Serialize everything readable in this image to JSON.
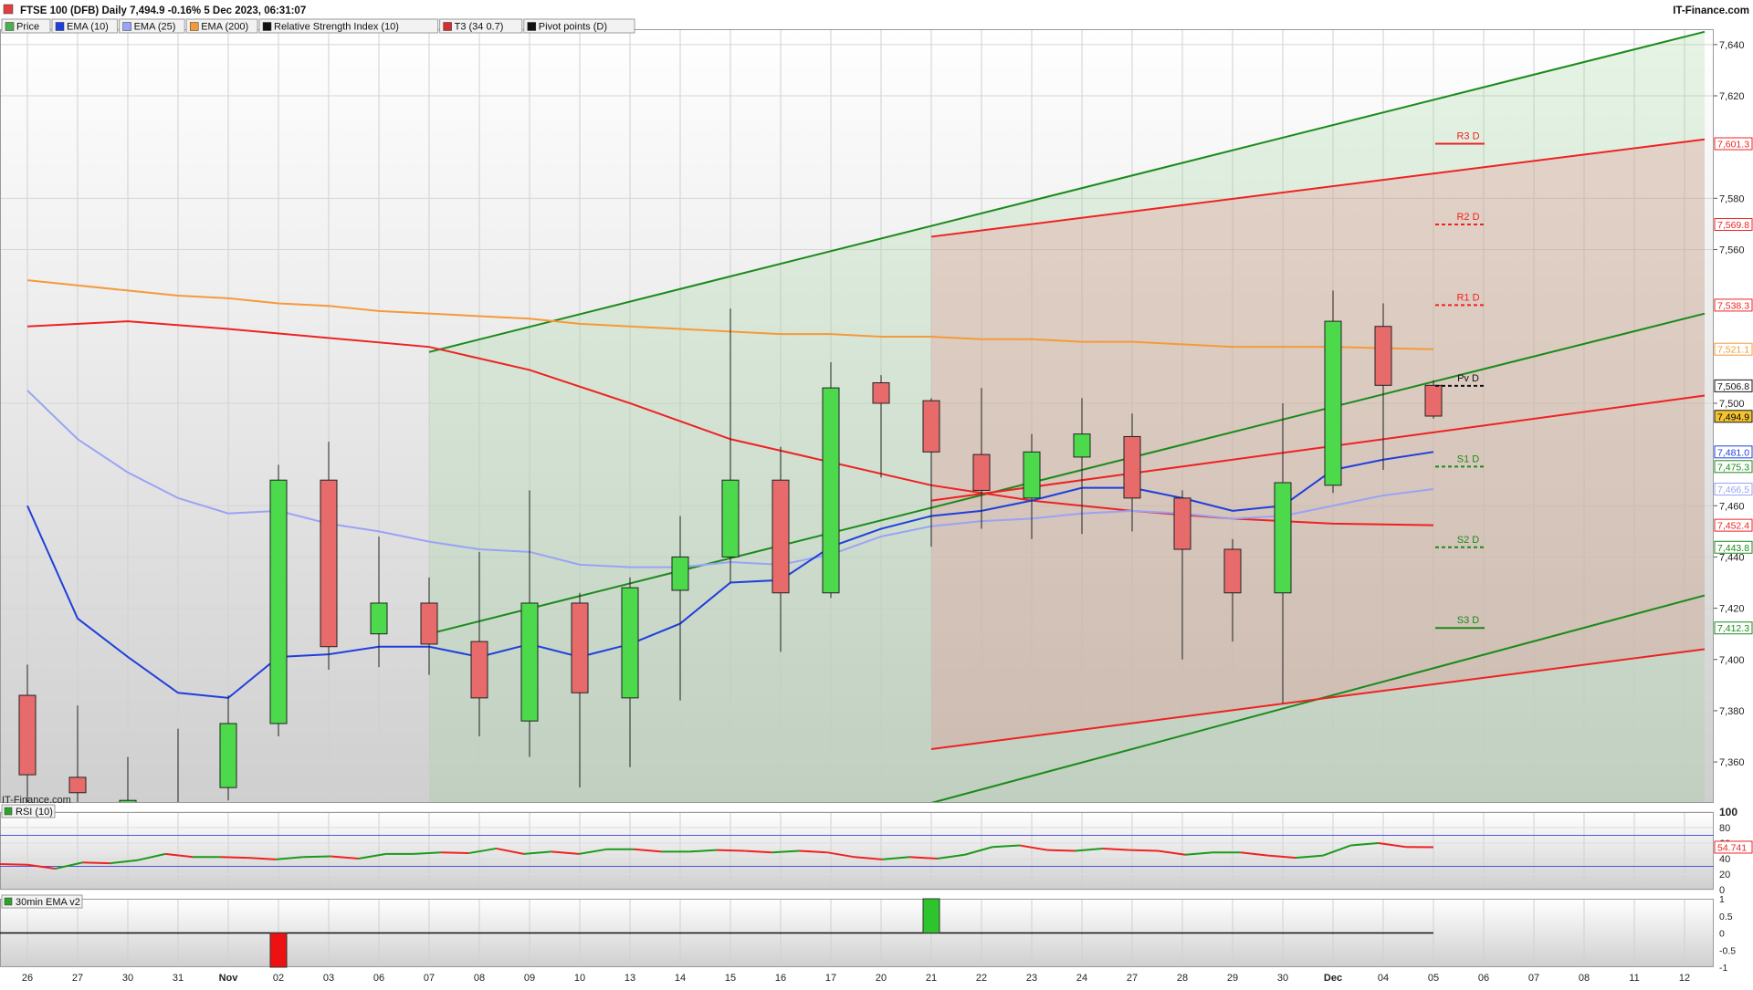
{
  "header": {
    "title": "FTSE 100 (DFB) Daily 7,494.9 -0.16% 5 Dec 2023, 06:31:07",
    "brand": "IT-Finance.com",
    "watermark": "IT-Finance.com"
  },
  "legend": [
    {
      "label": "Price",
      "color": "#4caf50"
    },
    {
      "label": "EMA (10)",
      "color": "#1f3fdd"
    },
    {
      "label": "EMA (25)",
      "color": "#9aa3f5"
    },
    {
      "label": "EMA (200)",
      "color": "#f59a3a"
    },
    {
      "label": "Relative Strength Index (10)",
      "color": "#111111"
    },
    {
      "label": "T3 (34 0.7)",
      "color": "#d32f2f"
    },
    {
      "label": "Pivot points (D)",
      "color": "#111111"
    }
  ],
  "colors": {
    "up": "#4cd94c",
    "down": "#e86b6b",
    "ema10": "#1f3fdd",
    "ema25": "#9aa3f5",
    "ema200": "#f59a3a",
    "t3": "#ee2222",
    "channel_green": "#1a8a1a",
    "channel_red": "#ee2222"
  },
  "chart_data": [
    {
      "type": "candlestick",
      "title": "FTSE 100 (DFB) Daily",
      "x_labels": [
        "26",
        "27",
        "30",
        "31",
        "Nov",
        "02",
        "03",
        "06",
        "07",
        "08",
        "09",
        "10",
        "13",
        "14",
        "15",
        "16",
        "17",
        "20",
        "21",
        "22",
        "23",
        "24",
        "27",
        "28",
        "29",
        "30",
        "Dec",
        "04",
        "05",
        "06",
        "07",
        "08",
        "11",
        "12"
      ],
      "ylim": [
        7344,
        7646
      ],
      "y_ticks": [
        7360,
        7380,
        7400,
        7420,
        7440,
        7460,
        7500,
        7560,
        7580,
        7620,
        7640
      ],
      "candles": [
        {
          "o": 7386,
          "h": 7398,
          "l": 7340,
          "c": 7355
        },
        {
          "o": 7354,
          "h": 7382,
          "l": 7340,
          "c": 7348
        },
        {
          "o": 7340,
          "h": 7362,
          "l": 7330,
          "c": 7345
        },
        {
          "o": 7340,
          "h": 7373,
          "l": 7333,
          "c": 7338
        },
        {
          "o": 7350,
          "h": 7386,
          "l": 7345,
          "c": 7375
        },
        {
          "o": 7375,
          "h": 7476,
          "l": 7370,
          "c": 7470
        },
        {
          "o": 7470,
          "h": 7485,
          "l": 7396,
          "c": 7405
        },
        {
          "o": 7410,
          "h": 7448,
          "l": 7397,
          "c": 7422
        },
        {
          "o": 7422,
          "h": 7432,
          "l": 7394,
          "c": 7406
        },
        {
          "o": 7407,
          "h": 7442,
          "l": 7370,
          "c": 7385
        },
        {
          "o": 7376,
          "h": 7466,
          "l": 7362,
          "c": 7422
        },
        {
          "o": 7422,
          "h": 7426,
          "l": 7350,
          "c": 7387
        },
        {
          "o": 7385,
          "h": 7432,
          "l": 7358,
          "c": 7428
        },
        {
          "o": 7427,
          "h": 7456,
          "l": 7384,
          "c": 7440
        },
        {
          "o": 7440,
          "h": 7537,
          "l": 7430,
          "c": 7470
        },
        {
          "o": 7470,
          "h": 7483,
          "l": 7403,
          "c": 7426
        },
        {
          "o": 7426,
          "h": 7516,
          "l": 7424,
          "c": 7506
        },
        {
          "o": 7508,
          "h": 7511,
          "l": 7471,
          "c": 7500
        },
        {
          "o": 7501,
          "h": 7502,
          "l": 7444,
          "c": 7481
        },
        {
          "o": 7480,
          "h": 7506,
          "l": 7451,
          "c": 7466
        },
        {
          "o": 7463,
          "h": 7488,
          "l": 7447,
          "c": 7481
        },
        {
          "o": 7479,
          "h": 7502,
          "l": 7449,
          "c": 7488
        },
        {
          "o": 7487,
          "h": 7496,
          "l": 7450,
          "c": 7463
        },
        {
          "o": 7463,
          "h": 7466,
          "l": 7400,
          "c": 7443
        },
        {
          "o": 7443,
          "h": 7447,
          "l": 7407,
          "c": 7426
        },
        {
          "o": 7426,
          "h": 7500,
          "l": 7383,
          "c": 7469
        },
        {
          "o": 7468,
          "h": 7544,
          "l": 7465,
          "c": 7532
        },
        {
          "o": 7530,
          "h": 7539,
          "l": 7474,
          "c": 7507
        },
        {
          "o": 7507,
          "h": 7509,
          "l": 7494,
          "c": 7495
        }
      ],
      "ema10": [
        7460,
        7416,
        7401,
        7387,
        7385,
        7401,
        7402,
        7405,
        7405,
        7401,
        7406,
        7401,
        7406,
        7414,
        7430,
        7431,
        7444,
        7451,
        7456,
        7458,
        7462,
        7467,
        7467,
        7463,
        7458,
        7460,
        7474,
        7478,
        7481
      ],
      "ema25": [
        7505,
        7486,
        7473,
        7463,
        7457,
        7458,
        7453,
        7450,
        7446,
        7443,
        7442,
        7437,
        7436,
        7436,
        7438,
        7437,
        7441,
        7448,
        7452,
        7454,
        7455,
        7457,
        7458,
        7457,
        7455,
        7456,
        7460,
        7464,
        7466.5
      ],
      "ema200": [
        7548,
        7546,
        7544,
        7542,
        7541,
        7539,
        7538,
        7536,
        7535,
        7534,
        7533,
        7531,
        7530,
        7529,
        7528,
        7527,
        7527,
        7526,
        7526,
        7525,
        7525,
        7524,
        7524,
        7523,
        7522,
        7522,
        7522,
        7521.5,
        7521.1
      ],
      "t3_line": [
        {
          "x": 0,
          "y": 7530
        },
        {
          "x": 2,
          "y": 7532
        },
        {
          "x": 4,
          "y": 7529
        },
        {
          "x": 8,
          "y": 7522
        },
        {
          "x": 10,
          "y": 7513
        },
        {
          "x": 12,
          "y": 7500
        },
        {
          "x": 14,
          "y": 7486
        },
        {
          "x": 16,
          "y": 7477
        },
        {
          "x": 18,
          "y": 7468
        },
        {
          "x": 20,
          "y": 7462
        },
        {
          "x": 22,
          "y": 7458
        },
        {
          "x": 24,
          "y": 7455
        },
        {
          "x": 26,
          "y": 7453
        },
        {
          "x": 28,
          "y": 7452.4
        }
      ],
      "channel_green_upper": [
        {
          "x": 8,
          "y": 7520
        },
        {
          "x": 33.4,
          "y": 7645
        }
      ],
      "channel_green_middle": [
        {
          "x": 8,
          "y": 7410
        },
        {
          "x": 33.4,
          "y": 7535
        }
      ],
      "channel_green_lower": [
        {
          "x": 18,
          "y": 7344
        },
        {
          "x": 33.4,
          "y": 7425
        }
      ],
      "channel_red_upper": [
        {
          "x": 18,
          "y": 7565
        },
        {
          "x": 33.4,
          "y": 7603
        }
      ],
      "channel_red_middle": [
        {
          "x": 18,
          "y": 7462
        },
        {
          "x": 33.4,
          "y": 7503
        }
      ],
      "channel_red_lower": [
        {
          "x": 18,
          "y": 7365
        },
        {
          "x": 33.4,
          "y": 7404
        }
      ],
      "pivots": [
        {
          "label": "R3 D",
          "value": 7601.3,
          "color": "#ee2222",
          "style": "solid"
        },
        {
          "label": "R2 D",
          "value": 7569.8,
          "color": "#ee2222",
          "style": "dashed"
        },
        {
          "label": "R1 D",
          "value": 7538.3,
          "color": "#ee2222",
          "style": "dashed"
        },
        {
          "label": "Pv D",
          "value": 7506.8,
          "color": "#111111",
          "style": "dashed"
        },
        {
          "label": "S1 D",
          "value": 7475.3,
          "color": "#1a8a1a",
          "style": "dashed"
        },
        {
          "label": "S2 D",
          "value": 7443.8,
          "color": "#1a8a1a",
          "style": "dashed"
        },
        {
          "label": "S3 D",
          "value": 7412.3,
          "color": "#1a8a1a",
          "style": "solid"
        }
      ],
      "value_tags": [
        {
          "text": "7,601.3",
          "value": 7601.3,
          "color": "#ee2222",
          "fill": "#ffffff"
        },
        {
          "text": "7,569.8",
          "value": 7569.8,
          "color": "#ee2222",
          "fill": "#ffffff"
        },
        {
          "text": "7,538.3",
          "value": 7538.3,
          "color": "#ee2222",
          "fill": "#ffffff"
        },
        {
          "text": "7,521.1",
          "value": 7521.1,
          "color": "#f59a3a",
          "fill": "#ffffff"
        },
        {
          "text": "7,506.8",
          "value": 7506.8,
          "color": "#111111",
          "fill": "#ffffff"
        },
        {
          "text": "7,494.9",
          "value": 7494.9,
          "color": "#111111",
          "fill": "#f4c430"
        },
        {
          "text": "7,481.0",
          "value": 7481.0,
          "color": "#1f3fdd",
          "fill": "#ffffff"
        },
        {
          "text": "7,475.3",
          "value": 7475.3,
          "color": "#1a8a1a",
          "fill": "#ffffff"
        },
        {
          "text": "7,466.5",
          "value": 7466.5,
          "color": "#9aa3f5",
          "fill": "#ffffff"
        },
        {
          "text": "7,452.4",
          "value": 7452.4,
          "color": "#ee2222",
          "fill": "#ffffff"
        },
        {
          "text": "7,443.8",
          "value": 7443.8,
          "color": "#1a8a1a",
          "fill": "#ffffff"
        },
        {
          "text": "7,412.3",
          "value": 7412.3,
          "color": "#1a8a1a",
          "fill": "#ffffff"
        }
      ]
    },
    {
      "type": "line",
      "title": "RSI (10)",
      "ylim": [
        0,
        100
      ],
      "y_ticks": [
        0,
        20,
        40,
        60,
        80,
        100
      ],
      "upper_band": 70,
      "lower_band": 30,
      "last_value_label": "54.741",
      "values": [
        33,
        32,
        27,
        35,
        34,
        38,
        46,
        42,
        42,
        41,
        39,
        42,
        43,
        40,
        46,
        46,
        48,
        47,
        53,
        46,
        49,
        46,
        52,
        52,
        49,
        49,
        51,
        50,
        48,
        50,
        48,
        42,
        39,
        42,
        40,
        45,
        55,
        57,
        51,
        50,
        53,
        51,
        50,
        45,
        48,
        48,
        44,
        41,
        44,
        57,
        60,
        55,
        54.7
      ]
    },
    {
      "type": "bar",
      "title": "30min EMA v2",
      "ylim": [
        -1,
        1
      ],
      "y_ticks": [
        "1",
        "0.5",
        "0",
        "-0.5",
        "-1"
      ],
      "bars": [
        {
          "x": 5,
          "value": -1
        },
        {
          "x": 18,
          "value": 1
        }
      ]
    }
  ]
}
